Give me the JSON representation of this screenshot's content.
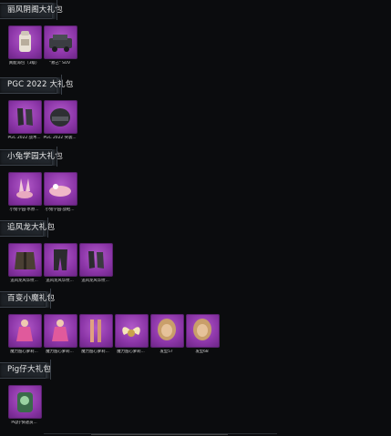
{
  "colors": {
    "bg": "#0b0c0e",
    "thumb": "#9b45b6",
    "accent_line": "#3a4048"
  },
  "sections": [
    {
      "title": "丽风阴阁大礼包",
      "items": [
        {
          "label": "真能海包（3级）",
          "icon": "backpack-icon"
        },
        {
          "label": "\"救己\" SUV",
          "icon": "suv-icon"
        }
      ]
    },
    {
      "title": "PGC 2022 大礼包",
      "items": [
        {
          "label": "PGC 2022 战术...",
          "icon": "gloves-icon"
        },
        {
          "label": "PGC 2022 突袭...",
          "icon": "helmet-icon"
        }
      ]
    },
    {
      "title": "小兔学园大礼包",
      "items": [
        {
          "label": "小兔学园·水原...",
          "icon": "bunny-ears-icon"
        },
        {
          "label": "小兔学园·战鞋...",
          "icon": "bunny-shoes-icon"
        }
      ]
    },
    {
      "title": "追风龙大礼包",
      "items": [
        {
          "label": "追风龙风华纹...",
          "icon": "jacket-icon"
        },
        {
          "label": "追风龙风华纹...",
          "icon": "pants-icon"
        },
        {
          "label": "追风龙风华纹...",
          "icon": "gloves-icon"
        }
      ]
    },
    {
      "title": "百变小魔礼包",
      "items": [
        {
          "label": "魔力甜心萝莉...",
          "icon": "outfit-icon"
        },
        {
          "label": "魔力甜心萝莉...",
          "icon": "outfit-icon"
        },
        {
          "label": "魔力甜心萝莉...",
          "icon": "legs-icon"
        },
        {
          "label": "魔力甜心萝莉...",
          "icon": "wings-icon"
        },
        {
          "label": "发型57",
          "icon": "hair-icon"
        },
        {
          "label": "发型68",
          "icon": "hair-icon"
        }
      ]
    },
    {
      "title": "Pig仔大礼包",
      "items": [
        {
          "label": "Pig仔快递员...",
          "icon": "pig-backpack-icon"
        }
      ]
    }
  ]
}
